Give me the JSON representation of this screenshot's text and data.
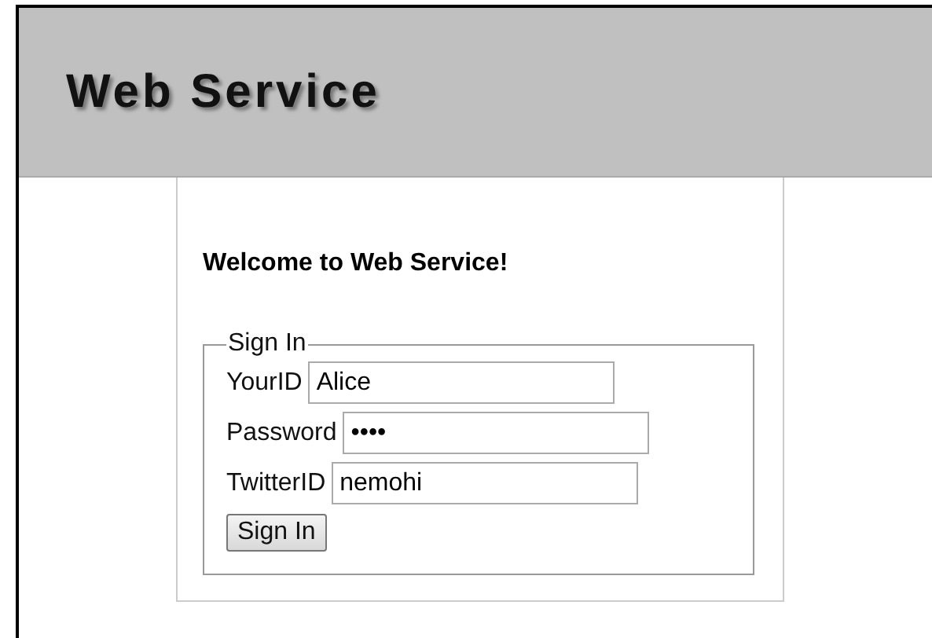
{
  "header": {
    "title": "Web Service"
  },
  "welcome": "Welcome to Web Service!",
  "sign_in": {
    "legend": "Sign In",
    "fields": [
      {
        "label": "YourID",
        "value": "Alice"
      },
      {
        "label": "Password",
        "value": "••••"
      },
      {
        "label": "TwitterID",
        "value": "nemohi"
      }
    ],
    "button": "Sign In"
  }
}
